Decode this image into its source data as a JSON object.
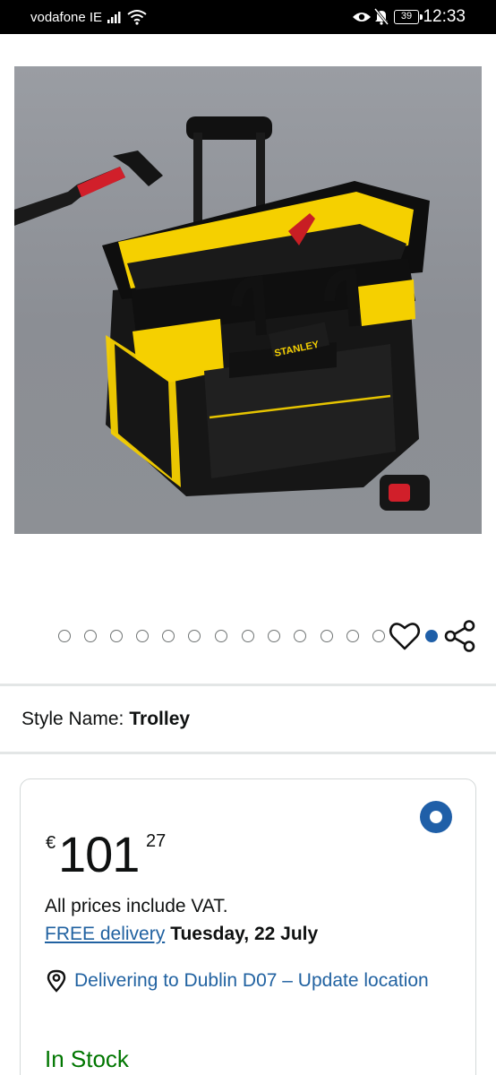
{
  "status_bar": {
    "carrier": "vodafone IE",
    "battery": "39",
    "time": "12:33"
  },
  "product": {
    "image_icon": "stanley-tool-trolley-bag-photo",
    "brand_on_image": "STANLEY"
  },
  "carousel": {
    "dot_count": 15,
    "active_index": 14,
    "wishlist_icon": "heart-icon",
    "share_icon": "share-icon"
  },
  "style": {
    "label": "Style Name:",
    "value": "Trolley"
  },
  "buy_box": {
    "price_symbol": "€",
    "price_whole": "101",
    "price_fraction": "27",
    "vat_note": "All prices include VAT.",
    "delivery_link": "FREE delivery",
    "delivery_date": "Tuesday, 22 July",
    "location_icon": "location-pin-icon",
    "location_text": "Delivering to Dublin D07 – Update location",
    "stock_status": "In Stock"
  },
  "colors": {
    "link": "#2162a1",
    "accent": "#1f5fa8",
    "stock": "#007600",
    "brand_yellow": "#f5d000"
  }
}
